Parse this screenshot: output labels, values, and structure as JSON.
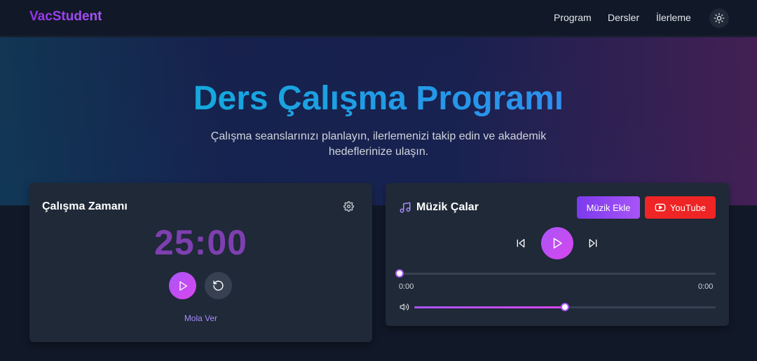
{
  "nav": {
    "brand": "VacStudent",
    "links": [
      "Program",
      "Dersler",
      "İlerleme"
    ],
    "theme_icon": "sun-icon"
  },
  "hero": {
    "title": "Ders Çalışma Programı",
    "subtitle": "Çalışma seanslarınızı planlayın, ilerlemenizi takip edin ve akademik hedeflerinize ulaşın."
  },
  "timer": {
    "title": "Çalışma Zamanı",
    "display": "25:00",
    "break_label": "Mola Ver",
    "settings_icon": "gear-icon",
    "play_icon": "play-icon",
    "reset_icon": "reset-icon"
  },
  "music": {
    "title": "Müzik Çalar",
    "title_icon": "music-note-icon",
    "add_label": "Müzik Ekle",
    "youtube_label": "YouTube",
    "current_time": "0:00",
    "duration": "0:00",
    "progress": 0,
    "volume": 0.5
  },
  "colors": {
    "accent_purple": "#a855f7",
    "accent_pink": "#d946ef",
    "youtube_red": "#ef4444",
    "card_bg": "#1f2937",
    "page_bg": "#111827"
  }
}
